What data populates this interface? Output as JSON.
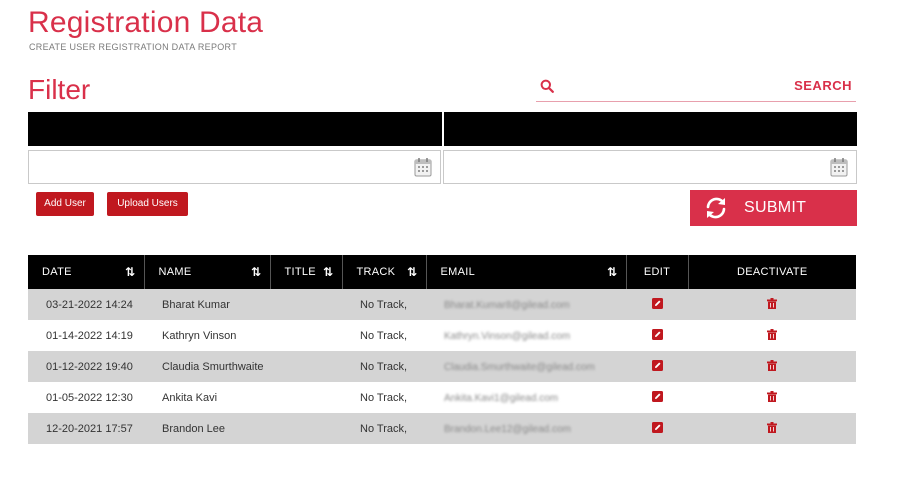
{
  "header": {
    "title": "Registration Data",
    "subtitle": "CREATE USER REGISTRATION DATA REPORT"
  },
  "filter": {
    "title": "Filter",
    "search_placeholder": "",
    "search_label": "SEARCH",
    "start_date_value": "",
    "end_date_value": ""
  },
  "actions": {
    "add_user": "Add User",
    "upload_users": "Upload Users",
    "submit": "SUBMIT"
  },
  "table": {
    "columns": [
      "DATE",
      "NAME",
      "TITLE",
      "TRACK",
      "EMAIL",
      "EDIT",
      "DEACTIVATE"
    ],
    "rows": [
      {
        "date": "03-21-2022 14:24",
        "name": "Bharat Kumar",
        "title": "",
        "track": "No Track,",
        "email": "Bharat.Kumar8@gilead.com"
      },
      {
        "date": "01-14-2022 14:19",
        "name": "Kathryn Vinson",
        "title": "",
        "track": "No Track,",
        "email": "Kathryn.Vinson@gilead.com"
      },
      {
        "date": "01-12-2022 19:40",
        "name": "Claudia Smurthwaite",
        "title": "",
        "track": "No Track,",
        "email": "Claudia.Smurthwaite@gilead.com"
      },
      {
        "date": "01-05-2022 12:30",
        "name": "Ankita Kavi",
        "title": "",
        "track": "No Track,",
        "email": "Ankita.Kavi1@gilead.com"
      },
      {
        "date": "12-20-2021 17:57",
        "name": "Brandon Lee",
        "title": "",
        "track": "No Track,",
        "email": "Brandon.Lee12@gilead.com"
      }
    ]
  },
  "icons": {
    "search": "search-icon",
    "calendar": "calendar-icon",
    "refresh": "refresh-icon",
    "sort": "sort-arrows-icon",
    "edit": "edit-icon",
    "delete": "trash-icon"
  },
  "colors": {
    "accent": "#d9304a",
    "button_red": "#c0181f",
    "header_black": "#000000",
    "row_shade": "#d4d4d4"
  }
}
